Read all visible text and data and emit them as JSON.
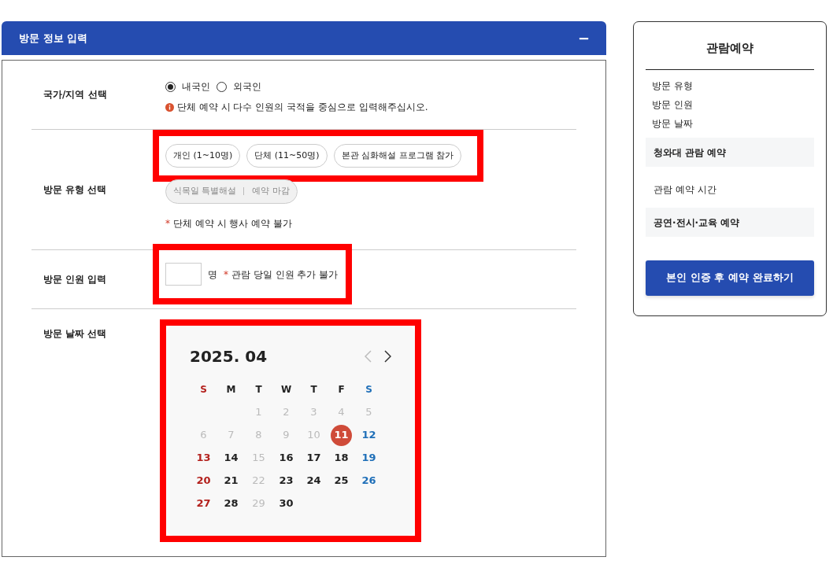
{
  "panel": {
    "title": "방문 정보 입력",
    "collapse_icon": "−"
  },
  "nationality": {
    "label": "국가/지역 선택",
    "options": [
      {
        "label": "내국인",
        "selected": true
      },
      {
        "label": "외국인",
        "selected": false
      }
    ],
    "note": "단체 예약 시 다수 인원의 국적을 중심으로 입력해주십시오."
  },
  "visit_type": {
    "label": "방문 유형 선택",
    "options": [
      {
        "parts": [
          "개인 (1~10명)"
        ],
        "disabled": false,
        "highlighted": true
      },
      {
        "parts": [
          "단체 (11~50명)"
        ],
        "disabled": false,
        "highlighted": true
      },
      {
        "parts": [
          "본관 심화해설 프로그램 참가"
        ],
        "disabled": false,
        "highlighted": true
      },
      {
        "parts": [
          "식목일 특별해설",
          "예약 마감"
        ],
        "disabled": true,
        "highlighted": false
      }
    ],
    "note_mark": "*",
    "note": "단체 예약 시 행사 예약 불가"
  },
  "visitors": {
    "label": "방문 인원 입력",
    "highlighted": true,
    "unit": "명",
    "note_mark": "*",
    "note": "관람 당일 인원 추가 불가"
  },
  "date": {
    "label": "방문 날짜 선택",
    "highlighted": true,
    "month": "2025. 04",
    "weekdays": [
      "S",
      "M",
      "T",
      "W",
      "T",
      "F",
      "S"
    ],
    "weeks": [
      [
        {
          "day": "1",
          "disabled": true,
          "selected": false
        },
        {
          "day": "2",
          "disabled": true,
          "selected": false
        },
        {
          "day": "3",
          "disabled": true,
          "selected": false
        },
        {
          "day": "4",
          "disabled": true,
          "selected": false
        },
        {
          "day": "5",
          "disabled": true,
          "selected": false
        }
      ],
      [
        {
          "day": "6",
          "disabled": true,
          "selected": false
        },
        {
          "day": "7",
          "disabled": true,
          "selected": false
        },
        {
          "day": "8",
          "disabled": true,
          "selected": false
        },
        {
          "day": "9",
          "disabled": true,
          "selected": false
        },
        {
          "day": "10",
          "disabled": true,
          "selected": false
        },
        {
          "day": "11",
          "disabled": false,
          "selected": true
        },
        {
          "day": "12",
          "disabled": false,
          "selected": false
        }
      ],
      [
        {
          "day": "13",
          "disabled": false,
          "selected": false
        },
        {
          "day": "14",
          "disabled": false,
          "selected": false
        },
        {
          "day": "15",
          "disabled": true,
          "selected": false
        },
        {
          "day": "16",
          "disabled": false,
          "selected": false
        },
        {
          "day": "17",
          "disabled": false,
          "selected": false
        },
        {
          "day": "18",
          "disabled": false,
          "selected": false
        },
        {
          "day": "19",
          "disabled": false,
          "selected": false
        }
      ],
      [
        {
          "day": "20",
          "disabled": false,
          "selected": false
        },
        {
          "day": "21",
          "disabled": false,
          "selected": false
        },
        {
          "day": "22",
          "disabled": true,
          "selected": false
        },
        {
          "day": "23",
          "disabled": false,
          "selected": false
        },
        {
          "day": "24",
          "disabled": false,
          "selected": false
        },
        {
          "day": "25",
          "disabled": false,
          "selected": false
        },
        {
          "day": "26",
          "disabled": false,
          "selected": false
        }
      ],
      [
        {
          "day": "27",
          "disabled": false,
          "selected": false
        },
        {
          "day": "28",
          "disabled": false,
          "selected": false
        },
        {
          "day": "29",
          "disabled": true,
          "selected": false
        },
        {
          "day": "30",
          "disabled": false,
          "selected": false
        }
      ]
    ]
  },
  "sidebar": {
    "title": "관람예약",
    "items": [
      {
        "kind": "plain",
        "label": "방문 유형"
      },
      {
        "kind": "plain",
        "label": "방문 인원"
      },
      {
        "kind": "plain",
        "label": "방문 날짜"
      },
      {
        "kind": "section",
        "label": "청와대 관람 예약"
      },
      {
        "kind": "item",
        "label": "관람 예약 시간"
      },
      {
        "kind": "section",
        "label": "공연·전시·교육 예약"
      }
    ],
    "button": "본인 인증 후 예약 완료하기"
  }
}
